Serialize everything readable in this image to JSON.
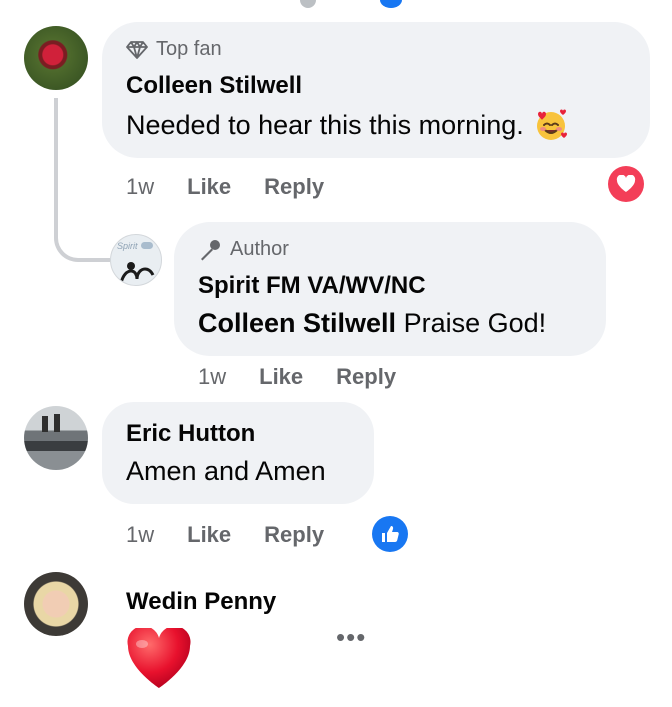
{
  "comments": [
    {
      "badge": "Top fan",
      "badge_icon": "diamond-icon",
      "name": "Colleen Stilwell",
      "text": "Needed to hear this this morning.",
      "emoji": "smiling-face-with-hearts-emoji",
      "time": "1w",
      "like_label": "Like",
      "reply_label": "Reply",
      "reaction": "love-reaction-icon",
      "reply": {
        "badge": "Author",
        "badge_icon": "microphone-icon",
        "name": "Spirit FM VA/WV/NC",
        "mention": "Colleen Stilwell",
        "text": "Praise God!",
        "time": "1w",
        "like_label": "Like",
        "reply_label": "Reply",
        "avatar_logo_text": "Spirit"
      }
    },
    {
      "name": "Eric Hutton",
      "text": "Amen and Amen",
      "time": "1w",
      "like_label": "Like",
      "reply_label": "Reply",
      "reaction": "like-reaction-icon"
    },
    {
      "name": "Wedin Penny",
      "content": "red-heart-emoji",
      "more": "•••"
    }
  ],
  "colors": {
    "bubble": "#f0f2f5",
    "secondary_text": "#65676b",
    "love": "#f33e58",
    "like": "#1877f2",
    "thread_line": "#ced0d4"
  }
}
